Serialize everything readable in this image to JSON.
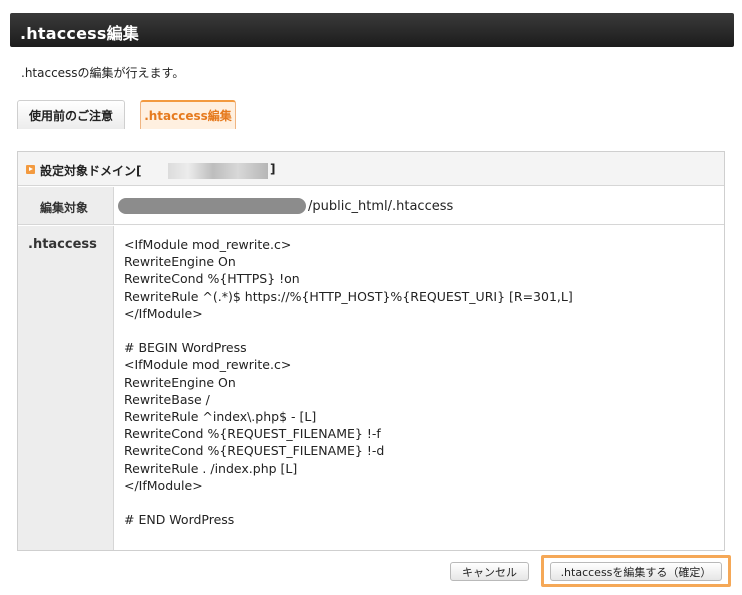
{
  "header": {
    "title": ".htaccess編集"
  },
  "intro": ".htaccessの編集が行えます。",
  "tabs": [
    {
      "label": "使用前のご注意",
      "active": false
    },
    {
      "label": ".htaccess編集",
      "active": true
    }
  ],
  "panel": {
    "heading_prefix": "設定対象ドメイン[",
    "heading_suffix": "]",
    "target_label": "編集対象",
    "target_path_suffix": "/public_html/.htaccess",
    "editor_label": ".htaccess",
    "editor_content": "<IfModule mod_rewrite.c>\nRewriteEngine On\nRewriteCond %{HTTPS} !on\nRewriteRule ^(.*)$ https://%{HTTP_HOST}%{REQUEST_URI} [R=301,L]\n</IfModule>\n\n# BEGIN WordPress\n<IfModule mod_rewrite.c>\nRewriteEngine On\nRewriteBase /\nRewriteRule ^index\\.php$ - [L]\nRewriteCond %{REQUEST_FILENAME} !-f\nRewriteCond %{REQUEST_FILENAME} !-d\nRewriteRule . /index.php [L]\n</IfModule>\n\n# END WordPress"
  },
  "buttons": {
    "cancel": "キャンセル",
    "confirm": ".htaccessを編集する（確定）"
  },
  "colors": {
    "accent": "#f39a3f",
    "header_bg": "#2a2a2a"
  }
}
